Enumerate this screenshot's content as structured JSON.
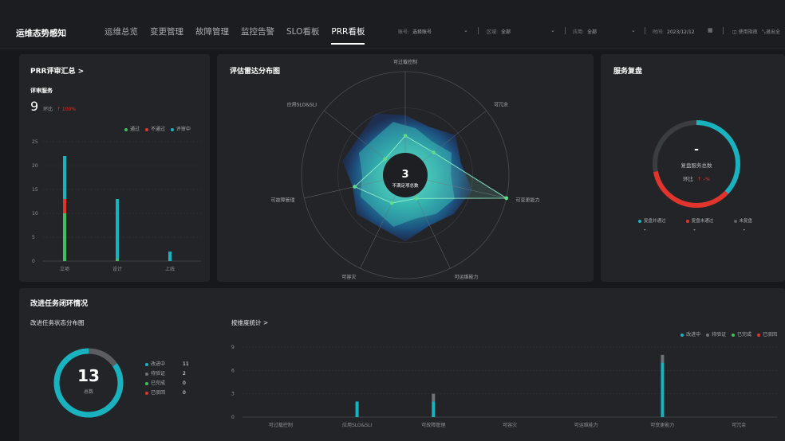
{
  "app": {
    "brand": "运维态势感知"
  },
  "nav": [
    {
      "label": "运维总览"
    },
    {
      "label": "变更管理"
    },
    {
      "label": "故障管理"
    },
    {
      "label": "监控告警"
    },
    {
      "label": "SLO看板"
    },
    {
      "label": "PRR看板"
    }
  ],
  "filters": {
    "account_label": "账号:",
    "account_value": "选择账号",
    "region_label": "区域:",
    "region_value": "全部",
    "app_label": "应用:",
    "app_value": "全部",
    "time_label": "时间:",
    "time_value": "2023/12/12",
    "guide": "使用指南",
    "exit": "退出全"
  },
  "prr": {
    "title": "PRR评审汇总 >",
    "subtitle": "评审服务",
    "count": "9",
    "ratio_label": "环比",
    "ratio_value": "↑ 100%",
    "legend": [
      {
        "name": "通过",
        "color": "#3fbf5f"
      },
      {
        "name": "不通过",
        "color": "#e0342c"
      },
      {
        "name": "评审中",
        "color": "#19b3bf"
      }
    ],
    "chart_data": {
      "type": "bar",
      "stacked": true,
      "categories": [
        "立项",
        "设计",
        "上线"
      ],
      "series": [
        {
          "name": "通过",
          "values": [
            10,
            0.5,
            0
          ]
        },
        {
          "name": "不通过",
          "values": [
            3,
            0,
            0
          ]
        },
        {
          "name": "评审中",
          "values": [
            9,
            12.5,
            2
          ]
        }
      ],
      "yticks": [
        "0",
        "5",
        "10",
        "15",
        "20",
        "25"
      ],
      "ylim": [
        0,
        25
      ]
    }
  },
  "radar": {
    "title": "评估雷达分布图",
    "center_value": "3",
    "center_label": "不满足项总数",
    "axes": [
      "可过载控制",
      "可冗余",
      "可变更能力",
      "可运维能力",
      "可容灾",
      "可故障管理",
      "应用SLO&SLI"
    ],
    "values": [
      0.38,
      0.35,
      1.0,
      0.25,
      0.3,
      0.5,
      0.25
    ]
  },
  "review": {
    "title": "服务复盘",
    "value": "-",
    "label": "复盘服务总数",
    "ratio_label": "环比",
    "ratio_value": "↑ -%",
    "ring_fraction": 0.72,
    "legend": [
      {
        "name": "复盘并通过",
        "value": "-",
        "color": "#19b3bf"
      },
      {
        "name": "复盘未通过",
        "value": "-",
        "color": "#e0342c"
      },
      {
        "name": "未复盘",
        "value": "-",
        "color": "#5d6166"
      }
    ]
  },
  "tasks": {
    "title": "改进任务闭环情况",
    "dist_title": "改进任务状态分布图",
    "total": "13",
    "total_label": "总数",
    "status": [
      {
        "name": "改进中",
        "value": "11",
        "color": "#19b3bf"
      },
      {
        "name": "待验证",
        "value": "2",
        "color": "#6f7378"
      },
      {
        "name": "已完成",
        "value": "0",
        "color": "#3fbf5f"
      },
      {
        "name": "已驳回",
        "value": "0",
        "color": "#e0342c"
      }
    ],
    "dim_title": "按维度统计 >",
    "dim_legend": [
      {
        "name": "改进中",
        "color": "#19b3bf"
      },
      {
        "name": "待验证",
        "color": "#6f7378"
      },
      {
        "name": "已完成",
        "color": "#3fbf5f"
      },
      {
        "name": "已驳回",
        "color": "#e0342c"
      }
    ],
    "chart_data": {
      "type": "bar",
      "stacked": true,
      "categories": [
        "可过载控制",
        "应用SLO&SLI",
        "可故障管理",
        "可容灾",
        "可运维能力",
        "可变更能力",
        "可冗余"
      ],
      "series": [
        {
          "name": "改进中",
          "values": [
            0,
            2,
            2,
            0,
            0,
            7,
            0
          ]
        },
        {
          "name": "待验证",
          "values": [
            0,
            0,
            1,
            0,
            0,
            1,
            0
          ]
        },
        {
          "name": "已完成",
          "values": [
            0,
            0,
            0,
            0,
            0,
            0,
            0
          ]
        },
        {
          "name": "已驳回",
          "values": [
            0,
            0,
            0,
            0,
            0,
            0,
            0
          ]
        }
      ],
      "yticks": [
        "0",
        "3",
        "6",
        "9"
      ],
      "ylim": [
        0,
        9
      ]
    }
  }
}
